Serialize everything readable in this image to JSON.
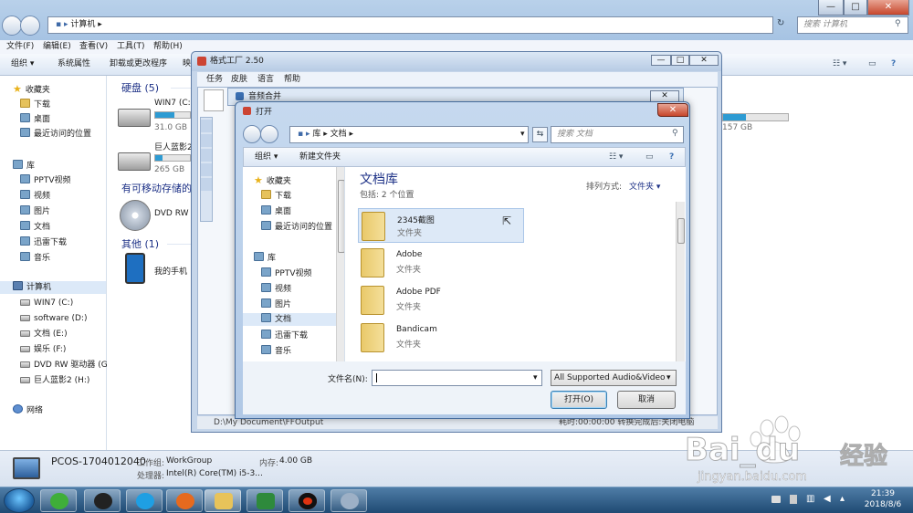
{
  "explorer": {
    "path": "计算机",
    "search_placeholder": "搜索 计算机",
    "menu": [
      "文件(F)",
      "编辑(E)",
      "查看(V)",
      "工具(T)",
      "帮助(H)"
    ],
    "toolbar": [
      "组织 ▾",
      "系统属性",
      "卸载或更改程序",
      "映"
    ],
    "nav": {
      "favorites": "收藏夹",
      "fav_items": [
        "下载",
        "桌面",
        "最近访问的位置"
      ],
      "libraries": "库",
      "lib_items": [
        "PPTV视频",
        "视频",
        "图片",
        "文档",
        "迅雷下载",
        "音乐"
      ],
      "computer": "计算机",
      "drives": [
        "WIN7 (C:)",
        "software (D:)",
        "文档 (E:)",
        "娱乐 (F:)",
        "DVD RW 驱动器 (G",
        "巨人蓝影2 (H:)"
      ],
      "network": "网络"
    },
    "groups": {
      "hdd": "硬盘 (5)",
      "removable": "有可移动存储的",
      "other": "其他 (1)"
    },
    "drive_c": {
      "name": "WIN7 (C:",
      "size": "31.0 GB",
      "fill": 0.55
    },
    "drive_h": {
      "name": "巨人蓝影2",
      "size": "265 GB",
      "fill": 0.2
    },
    "drive_far": {
      "size": "157 GB",
      "fill": 0.35
    },
    "dvd": "DVD RW",
    "phone": "我的手机",
    "details": {
      "pc_name": "PCOS-1704012040",
      "workgroup_label": "工作组:",
      "workgroup": "WorkGroup",
      "memory_label": "内存:",
      "memory": "4.00 GB",
      "cpu_label": "处理器:",
      "cpu": "Intel(R) Core(TM) i5-3..."
    }
  },
  "format_factory": {
    "title": "格式工厂 2.50",
    "menu": [
      "任务",
      "皮肤",
      "语言",
      "帮助"
    ],
    "status_path": "D:\\My Document\\FFOutput",
    "status_right": "耗时:00:00:00    转换完成后:关闭电脑"
  },
  "merge_dialog": {
    "title": "音频合并"
  },
  "open_dialog": {
    "title": "打开",
    "breadcrumb": [
      "库",
      "文档"
    ],
    "search_placeholder": "搜索 文档",
    "toolbar": {
      "organize": "组织 ▾",
      "new_folder": "新建文件夹"
    },
    "nav": {
      "favorites": "收藏夹",
      "fav_items": [
        "下载",
        "桌面",
        "最近访问的位置"
      ],
      "libraries": "库",
      "lib_items": [
        "PPTV视频",
        "视频",
        "图片",
        "文档",
        "迅雷下载",
        "音乐"
      ]
    },
    "library_title": "文档库",
    "includes": "包括: 2 个位置",
    "sort_label": "排列方式:",
    "sort_value": "文件夹 ▾",
    "files": [
      {
        "name": "2345截图",
        "type": "文件夹"
      },
      {
        "name": "Adobe",
        "type": "文件夹"
      },
      {
        "name": "Adobe PDF",
        "type": "文件夹"
      },
      {
        "name": "Bandicam",
        "type": "文件夹"
      }
    ],
    "filename_label": "文件名(N):",
    "filename_value": "",
    "filter": "All Supported Audio&Video",
    "open_button": "打开(O)",
    "cancel_button": "取消"
  },
  "taskbar": {
    "time": "21:39",
    "date": "2018/8/6"
  },
  "watermark": {
    "brand": "Bai",
    "brand2": "du",
    "cn": "经验",
    "url": "jingyan.baidu.com"
  }
}
